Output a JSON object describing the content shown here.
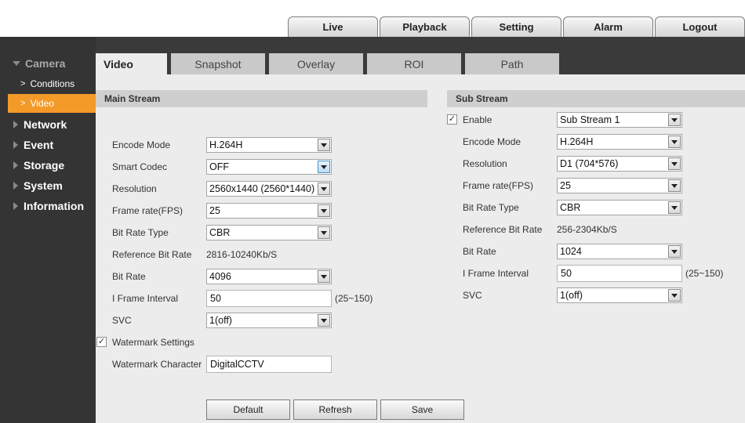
{
  "topnav": [
    "Live",
    "Playback",
    "Setting",
    "Alarm",
    "Logout"
  ],
  "sidebar": {
    "camera": "Camera",
    "subitems": [
      "Conditions",
      "Video"
    ],
    "categories": [
      "Network",
      "Event",
      "Storage",
      "System",
      "Information"
    ]
  },
  "tabs": [
    "Video",
    "Snapshot",
    "Overlay",
    "ROI",
    "Path"
  ],
  "main_stream": {
    "title": "Main Stream",
    "encode_mode_label": "Encode Mode",
    "encode_mode": "H.264H",
    "smart_codec_label": "Smart Codec",
    "smart_codec": "OFF",
    "resolution_label": "Resolution",
    "resolution": "2560x1440 (2560*1440)",
    "frame_rate_label": "Frame rate(FPS)",
    "frame_rate": "25",
    "bit_rate_type_label": "Bit Rate Type",
    "bit_rate_type": "CBR",
    "ref_bit_rate_label": "Reference Bit Rate",
    "ref_bit_rate": "2816-10240Kb/S",
    "bit_rate_label": "Bit Rate",
    "bit_rate": "4096",
    "iframe_label": "I Frame Interval",
    "iframe": "50",
    "iframe_hint": "(25~150)",
    "svc_label": "SVC",
    "svc": "1(off)",
    "watermark_settings_label": "Watermark Settings",
    "watermark_char_label": "Watermark Character",
    "watermark_char": "DigitalCCTV"
  },
  "sub_stream": {
    "title": "Sub Stream",
    "enable_label": "Enable",
    "enable": "Sub Stream 1",
    "encode_mode_label": "Encode Mode",
    "encode_mode": "H.264H",
    "resolution_label": "Resolution",
    "resolution": "D1 (704*576)",
    "frame_rate_label": "Frame rate(FPS)",
    "frame_rate": "25",
    "bit_rate_type_label": "Bit Rate Type",
    "bit_rate_type": "CBR",
    "ref_bit_rate_label": "Reference Bit Rate",
    "ref_bit_rate": "256-2304Kb/S",
    "bit_rate_label": "Bit Rate",
    "bit_rate": "1024",
    "iframe_label": "I Frame Interval",
    "iframe": "50",
    "iframe_hint": "(25~150)",
    "svc_label": "SVC",
    "svc": "1(off)"
  },
  "buttons": {
    "default": "Default",
    "refresh": "Refresh",
    "save": "Save"
  },
  "checks": {
    "watermark": "✓",
    "enable": "✓"
  },
  "colors": {
    "accent": "#f39a29",
    "sidebar": "#343434",
    "panel": "#ececec"
  }
}
